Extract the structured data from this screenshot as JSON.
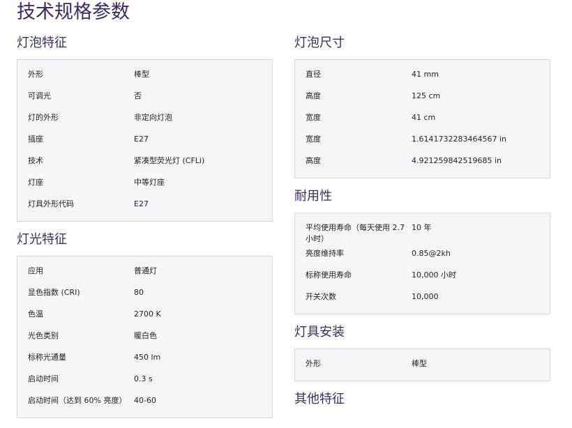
{
  "page_title": "技术规格参数",
  "left": [
    {
      "title": "灯泡特征",
      "rows": [
        {
          "k": "外形",
          "v": "棒型"
        },
        {
          "k": "可调光",
          "v": "否"
        },
        {
          "k": "灯的外形",
          "v": "非定向灯泡"
        },
        {
          "k": "插座",
          "v": "E27"
        },
        {
          "k": "技术",
          "v": "紧凑型荧光灯 (CFLi)"
        },
        {
          "k": "灯座",
          "v": "中等灯座"
        },
        {
          "k": "灯具外形代码",
          "v": "E27"
        }
      ]
    },
    {
      "title": "灯光特征",
      "rows": [
        {
          "k": "应用",
          "v": "普通灯"
        },
        {
          "k": "显色指数 (CRI)",
          "v": "80"
        },
        {
          "k": "色温",
          "v": "2700  K"
        },
        {
          "k": "光色类别",
          "v": "暖白色"
        },
        {
          "k": "标称光通量",
          "v": "450  lm"
        },
        {
          "k": "启动时间",
          "v": "0.3 s"
        },
        {
          "k": "启动时间（达到 60% 亮度）",
          "v": "40-60"
        }
      ]
    }
  ],
  "right": [
    {
      "title": "灯泡尺寸",
      "rows": [
        {
          "k": "直径",
          "v": "41  mm"
        },
        {
          "k": "高度",
          "v": "125  cm"
        },
        {
          "k": "宽度",
          "v": "41  cm"
        },
        {
          "k": "宽度",
          "v": "1.6141732283464567  in"
        },
        {
          "k": "高度",
          "v": "4.921259842519685  in"
        }
      ]
    },
    {
      "title": "耐用性",
      "rows": [
        {
          "k": "平均使用寿命（每天使用 2.7 小时）",
          "v": "10  年"
        },
        {
          "k": "亮度维持率",
          "v": "0.85@2kh"
        },
        {
          "k": "标称使用寿命",
          "v": "10,000  小时"
        },
        {
          "k": "开关次数",
          "v": "10,000"
        }
      ]
    },
    {
      "title": "灯具安装",
      "rows": [
        {
          "k": "外形",
          "v": "棒型"
        }
      ]
    },
    {
      "title": "其他特征",
      "rows": []
    }
  ]
}
